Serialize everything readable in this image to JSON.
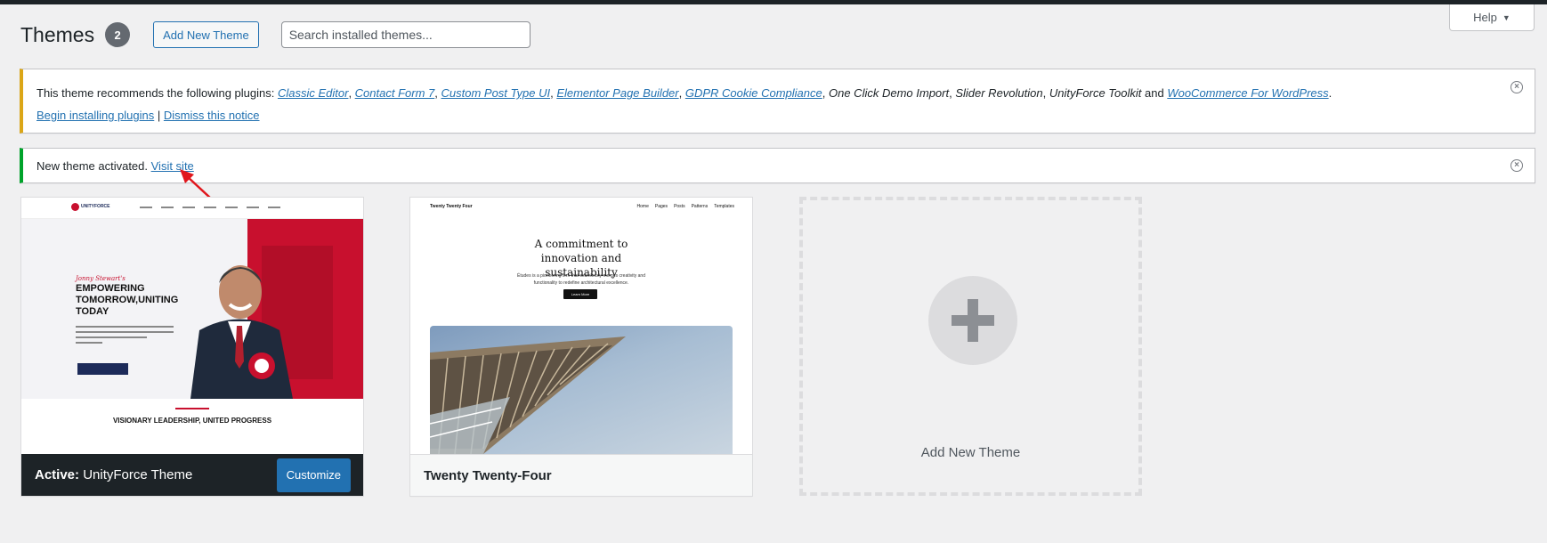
{
  "help": {
    "label": "Help",
    "caret": "▼"
  },
  "header": {
    "title": "Themes",
    "count": "2",
    "add_new_label": "Add New Theme",
    "search_placeholder": "Search installed themes..."
  },
  "plugin_notice": {
    "prefix": "This theme recommends the following plugins: ",
    "plugins": [
      {
        "name": "Classic Editor",
        "linked": true,
        "sep": ", "
      },
      {
        "name": "Contact Form 7",
        "linked": true,
        "sep": ", "
      },
      {
        "name": "Custom Post Type UI",
        "linked": true,
        "sep": ", "
      },
      {
        "name": "Elementor Page Builder",
        "linked": true,
        "sep": ", "
      },
      {
        "name": "GDPR Cookie Compliance",
        "linked": true,
        "sep": ", "
      },
      {
        "name": "One Click Demo Import",
        "linked": false,
        "sep": ", "
      },
      {
        "name": "Slider Revolution",
        "linked": false,
        "sep": ", "
      },
      {
        "name": "UnityForce Toolkit",
        "linked": false,
        "sep": " and "
      },
      {
        "name": "WooCommerce For WordPress",
        "linked": true,
        "sep": "."
      }
    ],
    "begin_link": "Begin installing plugins",
    "separator": " | ",
    "dismiss_link": "Dismiss this notice",
    "dismiss_icon": "dismiss-icon"
  },
  "activated_notice": {
    "text": "New theme activated. ",
    "link": "Visit site",
    "dismiss_icon": "dismiss-icon"
  },
  "themes": [
    {
      "active_prefix": "Active:",
      "name": "UnityForce Theme",
      "customize_label": "Customize",
      "preview": {
        "script_line": "Jonny Stewart's",
        "headline": "EMPOWERING TOMORROW,UNITING TODAY",
        "section_title": "VISIONARY LEADERSHIP, UNITED PROGRESS"
      }
    },
    {
      "name": "Twenty Twenty-Four",
      "preview": {
        "brand": "Twenty Twenty Four",
        "menu": [
          "Home",
          "Pages",
          "Posts",
          "Patterns",
          "Templates"
        ],
        "heading": "A commitment to innovation and sustainability",
        "desc": "Études is a pioneering firm that seamlessly merges creativity and functionality to redefine architectural excellence.",
        "button": "Learn More"
      }
    }
  ],
  "add_new_card": {
    "label": "Add New Theme",
    "icon": "plus-icon"
  },
  "colors": {
    "accent": "#2271b1",
    "warning": "#dba617",
    "success": "#00a32a",
    "dark": "#1d2327",
    "annotation_arrow": "#e0161c"
  }
}
